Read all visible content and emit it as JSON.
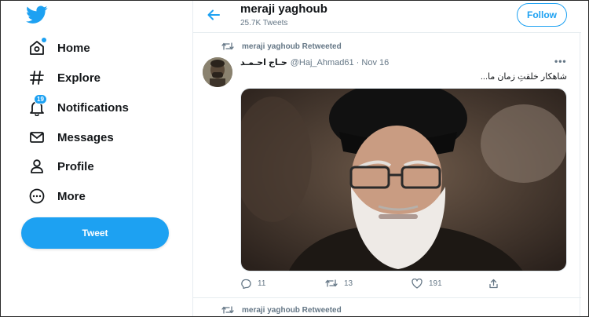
{
  "sidebar": {
    "logo_icon": "twitter-bird-icon",
    "accent": "#1da1f2",
    "items": [
      {
        "label": "Home",
        "icon": "home-icon"
      },
      {
        "label": "Explore",
        "icon": "hashtag-icon"
      },
      {
        "label": "Notifications",
        "icon": "bell-icon",
        "badge": "19"
      },
      {
        "label": "Messages",
        "icon": "envelope-icon"
      },
      {
        "label": "Profile",
        "icon": "person-icon"
      },
      {
        "label": "More",
        "icon": "more-circle-icon"
      }
    ],
    "tweet_button": "Tweet"
  },
  "header": {
    "name": "meraji yaghoub",
    "tweet_count": "25.7K Tweets",
    "follow_label": "Follow"
  },
  "tweets": [
    {
      "retweeted_by": "meraji yaghoub Retweeted",
      "author_name": "حـاج احـمـد",
      "author_meta": "@Haj_Ahmad61 · Nov 16",
      "text": "شاهکار خلقتِ زمان ما...",
      "replies": "11",
      "retweets": "13",
      "likes": "191"
    },
    {
      "retweeted_by": "meraji yaghoub Retweeted"
    }
  ]
}
